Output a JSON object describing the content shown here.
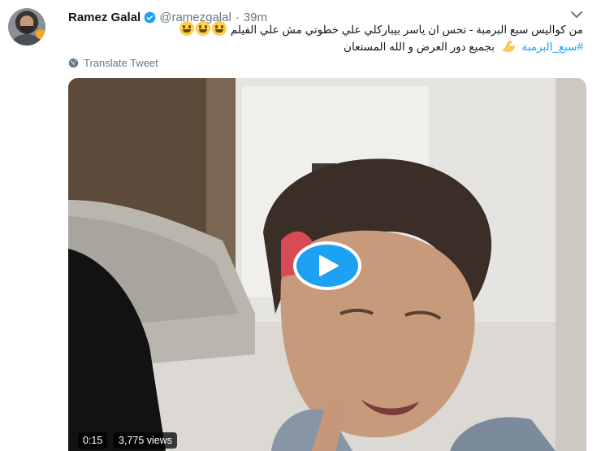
{
  "tweet": {
    "author": {
      "name": "Ramez Galal",
      "handle": "@ramezgalal",
      "separator": "·",
      "time": "39m"
    },
    "text_line1": "من كواليس سبع البرمبة - تحس ان ياسر بيباركلي علي خطوتي مش علي الفيلم",
    "hashtag": "#سبع_البرمبة",
    "text_line2": "بجميع دور العرض و الله المستعان",
    "translate": "Translate Tweet",
    "video": {
      "duration": "0:15",
      "views": "3,775 views"
    },
    "icons": {
      "verified": "verified-badge-icon",
      "menu": "chevron-down-icon",
      "translate": "globe-icon",
      "play": "play-icon",
      "emoji": "smiley-emoji-icon",
      "muscle": "flexed-biceps-emoji-icon"
    },
    "colors": {
      "accent": "#1da1f2",
      "secondary_text": "#657786",
      "primary_text": "#14171a"
    }
  }
}
